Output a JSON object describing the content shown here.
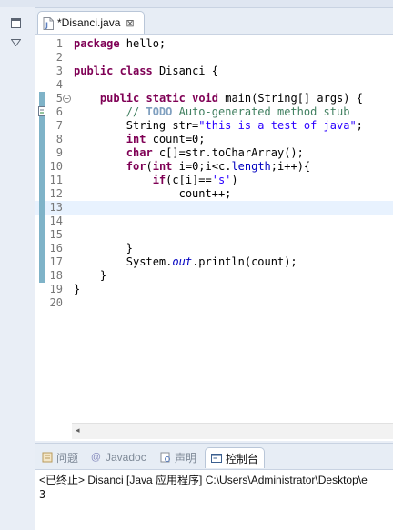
{
  "editor": {
    "tab_label": "*Disanci.java",
    "tab_close": "⊠",
    "lines": [
      {
        "n": "1",
        "segs": [
          {
            "t": "package",
            "c": "kw"
          },
          {
            "t": " hello;"
          }
        ]
      },
      {
        "n": "2",
        "segs": []
      },
      {
        "n": "3",
        "segs": [
          {
            "t": "public",
            "c": "kw"
          },
          {
            "t": " "
          },
          {
            "t": "class",
            "c": "kw"
          },
          {
            "t": " Disanci {"
          }
        ]
      },
      {
        "n": "4",
        "segs": []
      },
      {
        "n": "5",
        "fold": true,
        "mark": true,
        "segs": [
          {
            "t": "    "
          },
          {
            "t": "public",
            "c": "kw"
          },
          {
            "t": " "
          },
          {
            "t": "static",
            "c": "kw"
          },
          {
            "t": " "
          },
          {
            "t": "void",
            "c": "kw"
          },
          {
            "t": " main(String[] args) {"
          }
        ]
      },
      {
        "n": "6",
        "mark": true,
        "warn": true,
        "segs": [
          {
            "t": "        "
          },
          {
            "t": "// ",
            "c": "cm"
          },
          {
            "t": "TODO",
            "c": "todo"
          },
          {
            "t": " Auto-generated method stub",
            "c": "cm"
          }
        ]
      },
      {
        "n": "7",
        "mark": true,
        "segs": [
          {
            "t": "        String str="
          },
          {
            "t": "\"this is a test of java\"",
            "c": "str"
          },
          {
            "t": ";"
          }
        ]
      },
      {
        "n": "8",
        "mark": true,
        "segs": [
          {
            "t": "        "
          },
          {
            "t": "int",
            "c": "kw"
          },
          {
            "t": " count=0;"
          }
        ]
      },
      {
        "n": "9",
        "mark": true,
        "segs": [
          {
            "t": "        "
          },
          {
            "t": "char",
            "c": "kw"
          },
          {
            "t": " c[]=str.toCharArray();"
          }
        ]
      },
      {
        "n": "10",
        "mark": true,
        "segs": [
          {
            "t": "        "
          },
          {
            "t": "for",
            "c": "kw"
          },
          {
            "t": "("
          },
          {
            "t": "int",
            "c": "kw"
          },
          {
            "t": " i=0;i<c."
          },
          {
            "t": "length",
            "c": "fld"
          },
          {
            "t": ";i++){"
          }
        ]
      },
      {
        "n": "11",
        "mark": true,
        "segs": [
          {
            "t": "            "
          },
          {
            "t": "if",
            "c": "kw"
          },
          {
            "t": "(c[i]=="
          },
          {
            "t": "'s'",
            "c": "str"
          },
          {
            "t": ")"
          }
        ]
      },
      {
        "n": "12",
        "mark": true,
        "segs": [
          {
            "t": "                count++;"
          }
        ]
      },
      {
        "n": "13",
        "mark": true,
        "current": true,
        "segs": []
      },
      {
        "n": "14",
        "mark": true,
        "segs": []
      },
      {
        "n": "15",
        "mark": true,
        "segs": []
      },
      {
        "n": "16",
        "mark": true,
        "segs": [
          {
            "t": "        }"
          }
        ]
      },
      {
        "n": "17",
        "mark": true,
        "segs": [
          {
            "t": "        System."
          },
          {
            "t": "out",
            "c": "stat"
          },
          {
            "t": ".println(count);"
          }
        ]
      },
      {
        "n": "18",
        "mark": true,
        "segs": [
          {
            "t": "    }"
          }
        ]
      },
      {
        "n": "19",
        "segs": [
          {
            "t": "}"
          }
        ]
      },
      {
        "n": "20",
        "segs": []
      }
    ]
  },
  "bottom": {
    "tabs": [
      {
        "label": "问题",
        "icon": "problems-icon",
        "active": false
      },
      {
        "label": "Javadoc",
        "icon": "javadoc-icon",
        "active": false
      },
      {
        "label": "声明",
        "icon": "declaration-icon",
        "active": false
      },
      {
        "label": "控制台",
        "icon": "console-icon",
        "active": true
      }
    ],
    "console_status": "<已终止> Disanci [Java 应用程序] C:\\Users\\Administrator\\Desktop\\e",
    "console_output": "3"
  },
  "colors": {
    "keyword": "#7f0055",
    "string": "#2a00ff",
    "comment": "#3f7f5f",
    "todo": "#7f9fbf",
    "field": "#0000c0",
    "change_mark": "#7fb3c8",
    "current_line": "#e8f2fe"
  }
}
